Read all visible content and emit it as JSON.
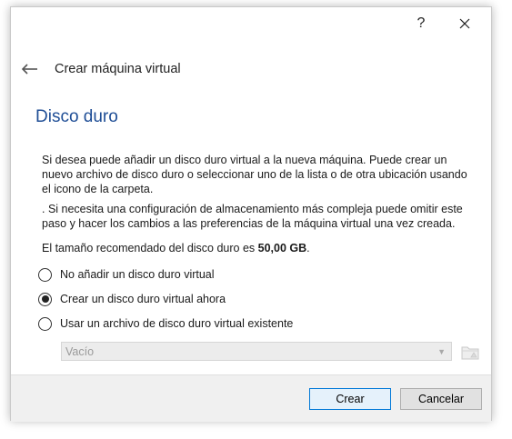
{
  "titlebar": {
    "help_glyph": "?",
    "close_glyph": "✕"
  },
  "nav": {
    "title": "Crear máquina virtual"
  },
  "section": {
    "title": "Disco duro"
  },
  "description": {
    "paragraph1": "Si desea puede añadir un disco duro virtual a la nueva máquina. Puede crear un nuevo archivo de disco duro o seleccionar uno de la lista o de otra ubicación usando el icono de la carpeta.",
    "paragraph2": ". Si necesita una configuración de almacenamiento más compleja puede omitir este paso y hacer los cambios a las preferencias de la máquina virtual una vez creada.",
    "recommended_prefix": "El tamaño recomendado del disco duro es ",
    "recommended_size": "50,00 GB",
    "recommended_suffix": "."
  },
  "options": [
    {
      "label": "No añadir un disco duro virtual",
      "selected": false
    },
    {
      "label": "Crear un disco duro virtual ahora",
      "selected": true
    },
    {
      "label": "Usar un archivo de disco duro virtual existente",
      "selected": false
    }
  ],
  "existing_file": {
    "combo_value": "Vacío",
    "folder_icon": "folder-icon"
  },
  "footer": {
    "create_label": "Crear",
    "cancel_label": "Cancelar"
  },
  "colors": {
    "title_blue": "#1f4e96",
    "primary_border": "#0078d7"
  }
}
